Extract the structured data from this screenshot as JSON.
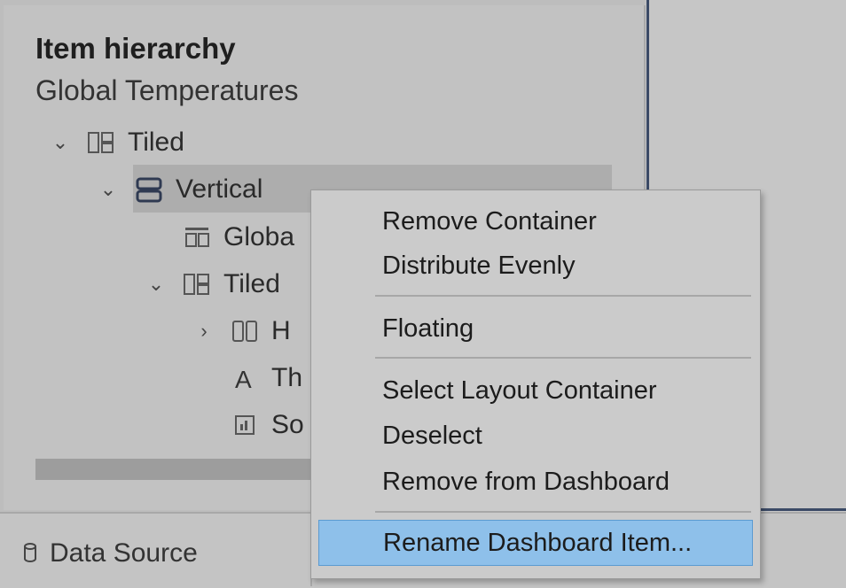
{
  "panel": {
    "title": "Item hierarchy",
    "subtitle": "Global Temperatures",
    "tree": [
      {
        "chevron": "⌄",
        "icon": "tiled-container-icon",
        "label": "Tiled"
      },
      {
        "chevron": "⌄",
        "icon": "vertical-container-icon",
        "label": "Vertical"
      },
      {
        "chevron": "",
        "icon": "title-icon",
        "label": "Globa"
      },
      {
        "chevron": "⌄",
        "icon": "tiled-container-icon",
        "label": "Tiled"
      },
      {
        "chevron": "›",
        "icon": "horizontal-container-icon",
        "label": "H"
      },
      {
        "chevron": "",
        "icon": "text-icon",
        "label": "Th"
      },
      {
        "chevron": "",
        "icon": "sheet-icon",
        "label": "So"
      }
    ]
  },
  "bottom": {
    "data_source_label": "Data Source"
  },
  "context_menu": {
    "items": [
      "Remove Container",
      "Distribute Evenly",
      "Floating",
      "Select Layout Container",
      "Deselect",
      "Remove from Dashboard",
      "Rename Dashboard Item..."
    ]
  },
  "colors": {
    "highlight": "#8ec0ea",
    "divider": "#3b4a66"
  }
}
